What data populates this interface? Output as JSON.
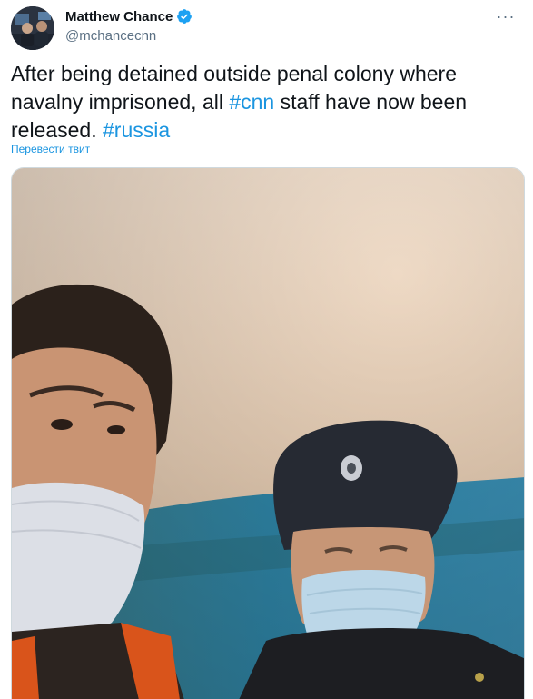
{
  "author": {
    "display_name": "Matthew Chance",
    "handle": "@mchancecnn",
    "verified_icon": "verified-badge-icon",
    "avatar_icon": "avatar-image"
  },
  "menu": {
    "more_icon": "more-options-icon",
    "more_glyph": "···"
  },
  "tweet": {
    "text_part1": "After being detained outside penal colony where navalny imprisoned, all ",
    "hashtag1": "#cnn",
    "text_part2": " staff have now  been released. ",
    "hashtag2": "#russia"
  },
  "translate_label": "Перевести твит",
  "media": {
    "description_icon": "photo-selfie-two-masked-men"
  },
  "colors": {
    "accent": "#1b95e0",
    "text": "#0f1419",
    "secondary": "#5b7083",
    "verified": "#1da1f2"
  }
}
